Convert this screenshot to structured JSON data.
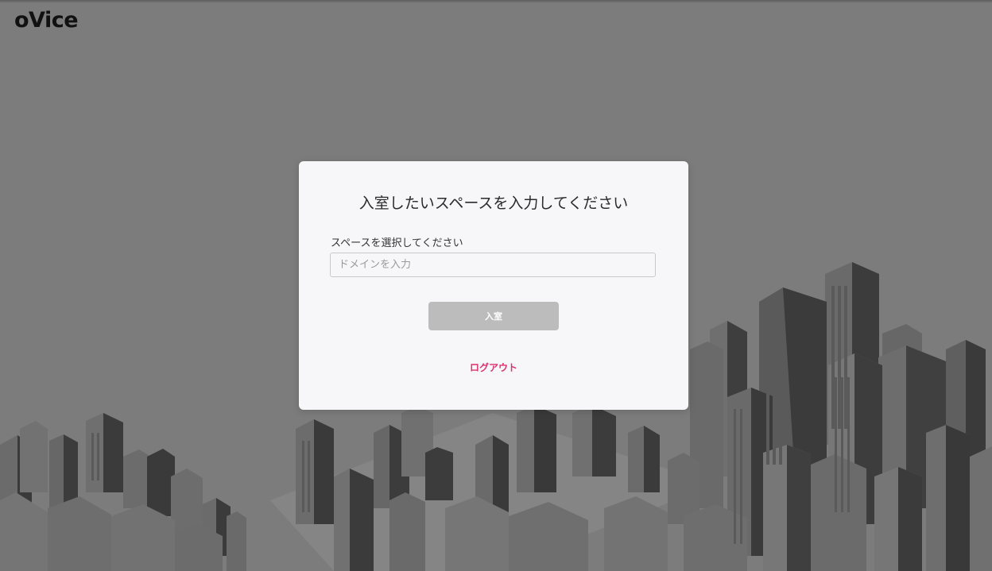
{
  "app": {
    "logo_text": "oVice"
  },
  "modal": {
    "title": "入室したいスペースを入力してください",
    "field_label": "スペースを選択してください",
    "input_placeholder": "ドメインを入力",
    "input_value": "",
    "enter_button_label": "入室",
    "logout_label": "ログアウト"
  },
  "colors": {
    "overlay": "#7c7c7c",
    "modal_bg": "#f7f7f9",
    "button_disabled": "#bcbcbc",
    "logout_accent": "#e0306b"
  }
}
